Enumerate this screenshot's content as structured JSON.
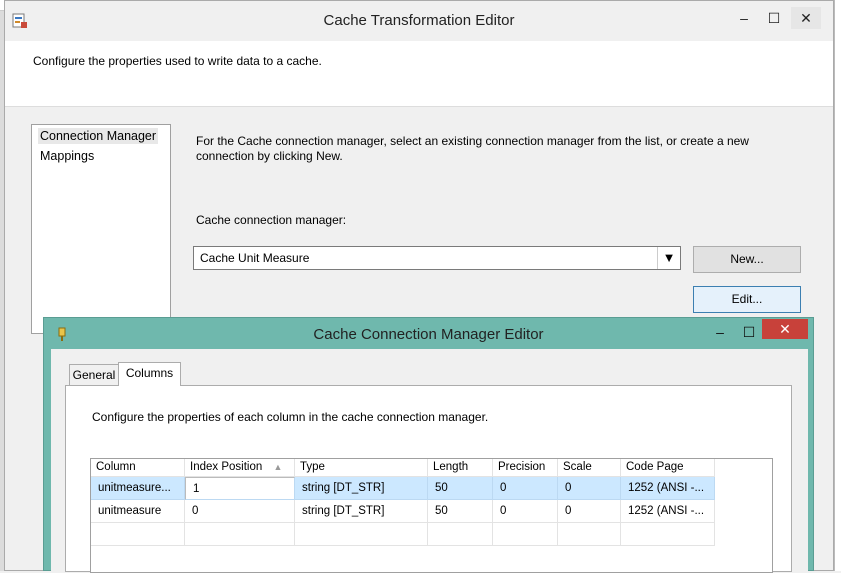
{
  "outer": {
    "title": "Cache Transformation Editor",
    "header_text": "Configure the properties used to write data to a cache.",
    "nav": [
      {
        "label": "Connection Manager"
      },
      {
        "label": "Mappings"
      }
    ],
    "description": "For the Cache connection manager, select an existing connection manager from the list, or create a new connection by clicking New.",
    "ccm_label": "Cache connection manager:",
    "ccm_value": "Cache Unit Measure",
    "new_button": "New...",
    "edit_button": "Edit...",
    "window_buttons": {
      "minimize": "–",
      "maximize": "☐",
      "close": "✕"
    }
  },
  "inner": {
    "title": "Cache Connection Manager Editor",
    "window_buttons": {
      "minimize": "–",
      "maximize": "☐",
      "close": "✕"
    },
    "tabs": [
      {
        "label": "General"
      },
      {
        "label": "Columns"
      }
    ],
    "description": "Configure the properties of each column in the cache connection manager.",
    "columns": [
      {
        "label": "Column"
      },
      {
        "label": "Index Position"
      },
      {
        "label": "Type"
      },
      {
        "label": "Length"
      },
      {
        "label": "Precision"
      },
      {
        "label": "Scale"
      },
      {
        "label": "Code Page"
      }
    ],
    "sort_indicator": "▲",
    "rows": [
      {
        "column": "unitmeasure...",
        "index": "1",
        "type": "string [DT_STR]",
        "length": "50",
        "precision": "0",
        "scale": "0",
        "codepage": "1252  (ANSI -..."
      },
      {
        "column": "unitmeasure",
        "index": "0",
        "type": "string [DT_STR]",
        "length": "50",
        "precision": "0",
        "scale": "0",
        "codepage": "1252  (ANSI -..."
      }
    ]
  }
}
